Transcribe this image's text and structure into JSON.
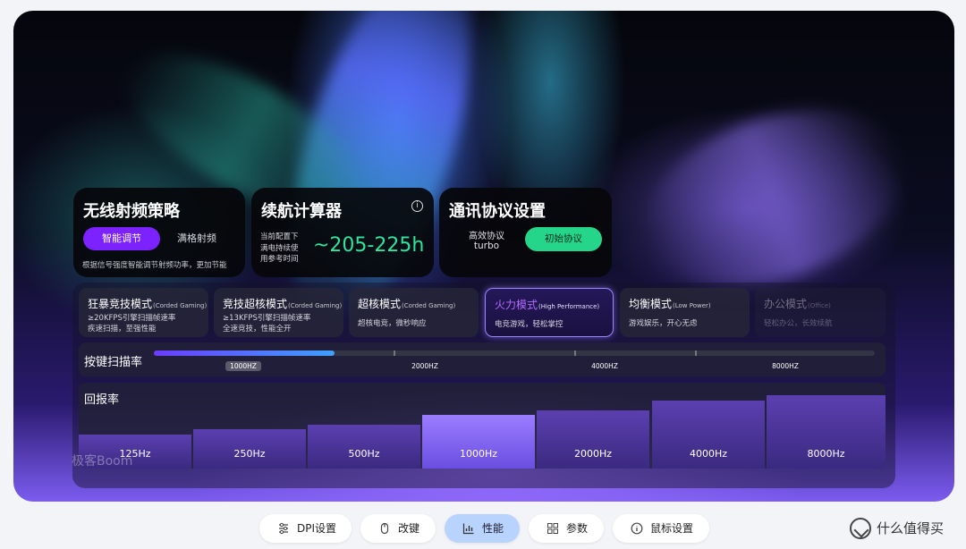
{
  "rf_strategy": {
    "title": "无线射频策略",
    "active_option": "智能调节",
    "other_option": "满格射频",
    "description": "根据信号强度智能调节射频功率，更加节能"
  },
  "battery": {
    "title": "续航计算器",
    "info_glyph": "i",
    "line1": "当前配置下",
    "line2": "满电持续使",
    "line3": "用参考时间",
    "value": "~205-225h"
  },
  "protocol": {
    "title": "通讯协议设置",
    "name": "高效协议",
    "value": "turbo",
    "button": "初始协议"
  },
  "modes": [
    {
      "name": "狂暴竞技模式",
      "en": "(Corded Gaming)",
      "desc1": "≥20KFPS引擎扫描帧速率",
      "desc2": "疾速扫描，至强性能"
    },
    {
      "name": "竞技超核模式",
      "en": "(Corded Gaming)",
      "desc1": "≥13KFPS引擎扫描帧速率",
      "desc2": "全速竞技，性能全开"
    },
    {
      "name": "超核模式",
      "en": "(Corded Gaming)",
      "desc1": "超核电竞，微秒响应",
      "desc2": ""
    },
    {
      "name": "火力模式",
      "en": "(High Performance)",
      "desc1": "电竞游戏，轻松掌控",
      "desc2": ""
    },
    {
      "name": "均衡模式",
      "en": "(Low Power)",
      "desc1": "游戏娱乐，开心无虑",
      "desc2": ""
    },
    {
      "name": "办公模式",
      "en": "(Office)",
      "desc1": "轻松办公，长效续航",
      "desc2": ""
    }
  ],
  "active_mode_index": 3,
  "scan_rate": {
    "label": "按键扫描率",
    "options": [
      "1000HZ",
      "2000HZ",
      "4000HZ",
      "8000HZ"
    ],
    "selected": "1000HZ",
    "fill_fraction": 0.25
  },
  "report_rate": {
    "label": "回报率",
    "options": [
      "125Hz",
      "250Hz",
      "500Hz",
      "1000Hz",
      "2000Hz",
      "4000Hz",
      "8000Hz"
    ],
    "selected": "1000Hz"
  },
  "watermark": "极客Boom",
  "tabs": [
    {
      "label": "DPI设置",
      "icon": "sliders-icon"
    },
    {
      "label": "改键",
      "icon": "mouse-icon"
    },
    {
      "label": "性能",
      "icon": "chart-icon"
    },
    {
      "label": "参数",
      "icon": "grid-icon"
    },
    {
      "label": "鼠标设置",
      "icon": "info-icon"
    }
  ],
  "active_tab": "性能",
  "brand": "什么值得买",
  "colors": {
    "accent_purple": "#7b22ff",
    "accent_green": "#24d58a",
    "battery_value": "#2ee59d",
    "active_tab_bg": "#b9d3ff"
  }
}
